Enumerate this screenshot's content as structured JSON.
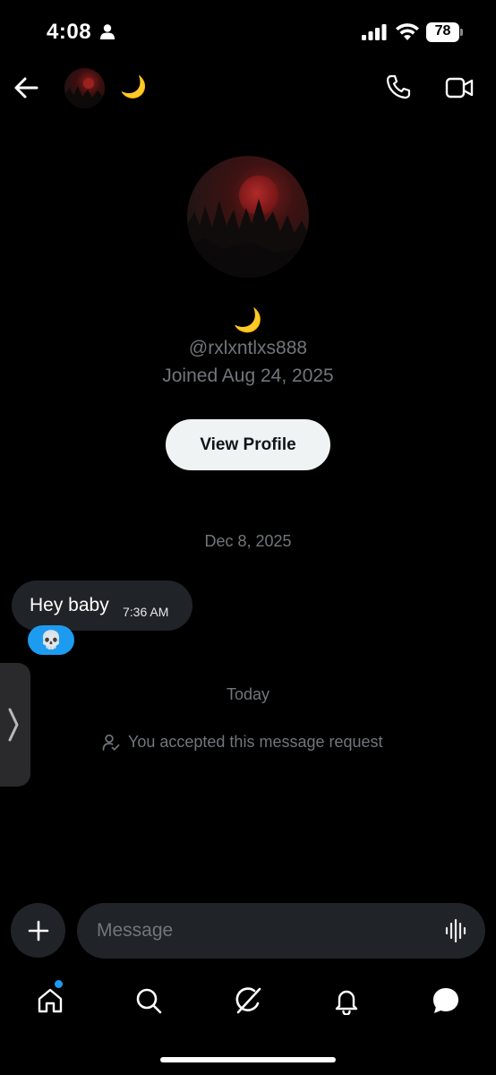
{
  "status_bar": {
    "time": "4:08",
    "battery": "78"
  },
  "header": {
    "name": "🌙"
  },
  "profile": {
    "name": "🌙",
    "handle": "@rxlxntlxs888",
    "joined": "Joined Aug 24, 2025",
    "view_profile_label": "View Profile"
  },
  "conversation": {
    "date_separator_1": "Dec 8, 2025",
    "messages": [
      {
        "text": "Hey baby",
        "time": "7:36 AM",
        "reaction": "💀"
      }
    ],
    "date_separator_2": "Today",
    "system_notice": "You accepted this message request"
  },
  "composer": {
    "placeholder": "Message"
  },
  "colors": {
    "background": "#000000",
    "accent": "#1d9bf0",
    "bubble": "#202327",
    "muted_text": "#71767b"
  },
  "icons": [
    "person-icon",
    "signal-icon",
    "wifi-icon",
    "back-arrow-icon",
    "phone-icon",
    "video-camera-icon",
    "chevron-right-icon",
    "plus-icon",
    "voice-waveform-icon",
    "home-icon",
    "search-icon",
    "grok-icon",
    "bell-icon",
    "messages-icon"
  ]
}
